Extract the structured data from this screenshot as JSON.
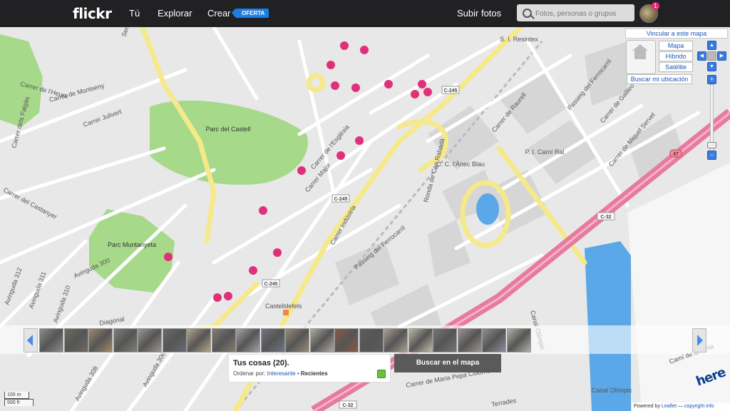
{
  "nav": {
    "logo": "flickr",
    "tu": "Tú",
    "explorar": "Explorar",
    "crear": "Crear",
    "oferta": "OFERTA",
    "subir": "Subir fotos",
    "search_placeholder": "Fotos, personas o grupos",
    "notifications": "1"
  },
  "map_controls": {
    "vincular": "Vincular a este mapa",
    "types": [
      "Mapa",
      "Híbrido",
      "Satélite"
    ],
    "buscar_ubicacion": "Buscar mi ubicación",
    "zoom_in": "+",
    "zoom_out": "−"
  },
  "map_labels": {
    "streets": [
      "Sentiu",
      "Carrer de l'Heura",
      "Carrer dels Falgàs",
      "Carrer de Montseny",
      "Carrer Julivert",
      "Carrer del Castanyer",
      "Avinguda 311",
      "Avinguda 310",
      "Avinguda 312",
      "Avinguda 300",
      "Diagonal",
      "Avinguda 306",
      "Avinguda 308",
      "Carrer de l'Església",
      "Carrer Major",
      "Carrer Indústria",
      "Passeig del Ferrocarril",
      "Ronda de Can Rabadà",
      "Carrer de Raurell",
      "Passeig del Ferrocarril",
      "Carrer de Galileo",
      "Carrer de Miquel Servet",
      "Camí de la Línia",
      "Canal Olímpic",
      "Carrer de Maria Pepa Colomer",
      "Terrades"
    ],
    "places": [
      "Parc del Castell",
      "Parc Muntanyeta",
      "S. I. Resintex",
      "C. C. l'Ànec Blau",
      "P. I. Camí Ral",
      "Castelldefels",
      "Canal Olímpic"
    ],
    "road_badges": [
      "C-245",
      "C-245",
      "C-245",
      "C-32",
      "C-32",
      "47"
    ]
  },
  "strip": {
    "thumb_count": 20
  },
  "panel": {
    "title": "Tus cosas (20).",
    "sort_label": "Ordenar por:",
    "sort_interesting": "Interesante",
    "sort_sep": "•",
    "sort_recent": "Recientes"
  },
  "buscar_mapa": "Buscar en el mapa",
  "scale": {
    "meters": "100 m",
    "feet": "500 ft"
  },
  "attribution": {
    "powered": "Powered by",
    "leaflet": "Leaflet",
    "sep": "—",
    "copyright": "copyright info"
  },
  "here_logo": "here",
  "colors": {
    "topbar": "#212124",
    "marker": "#e0307a",
    "highway": "#e67aa0",
    "park": "#a7d98a",
    "water": "#5aa8e8",
    "accent": "#1c7ee3"
  }
}
